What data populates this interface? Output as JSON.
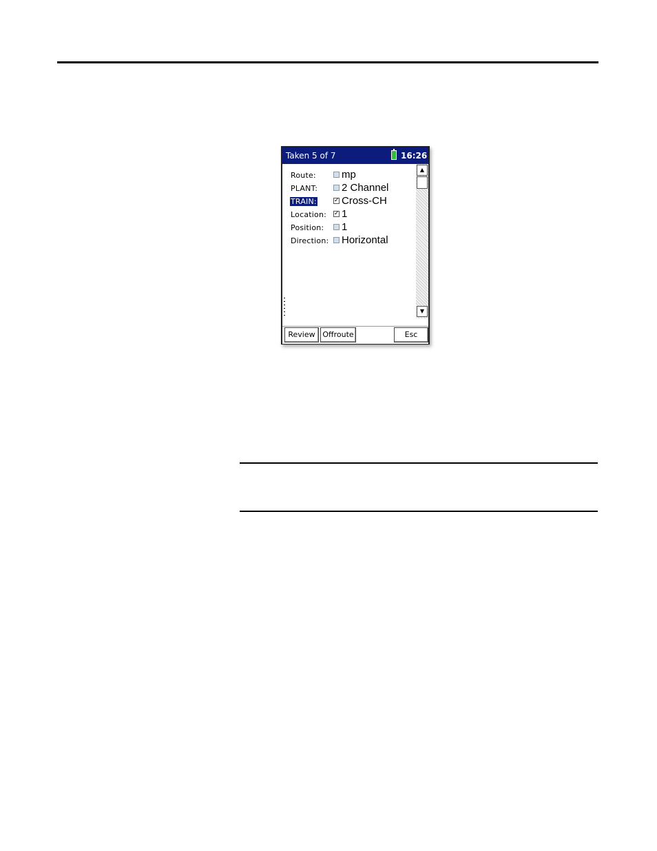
{
  "device": {
    "title": "Taken 5 of 7",
    "clock": "16:26",
    "battery_color": "#2fbf3b",
    "titlebar_color": "#0b1c7c"
  },
  "fields": [
    {
      "label": "Route:",
      "checked": false,
      "value": "mp"
    },
    {
      "label": "PLANT:",
      "checked": false,
      "value": "2 Channel"
    },
    {
      "label": "TRAIN:",
      "checked": true,
      "value": "Cross-CH",
      "selected": true
    },
    {
      "label": "Location:",
      "checked": true,
      "value": "1"
    },
    {
      "label": "Position:",
      "checked": false,
      "value": "1"
    },
    {
      "label": "Direction:",
      "checked": false,
      "value": "Horizontal"
    }
  ],
  "softkeys": {
    "review": "Review",
    "offroute": "Offroute",
    "esc": "Esc"
  },
  "scroll": {
    "up_glyph": "▲",
    "down_glyph": "▼"
  }
}
